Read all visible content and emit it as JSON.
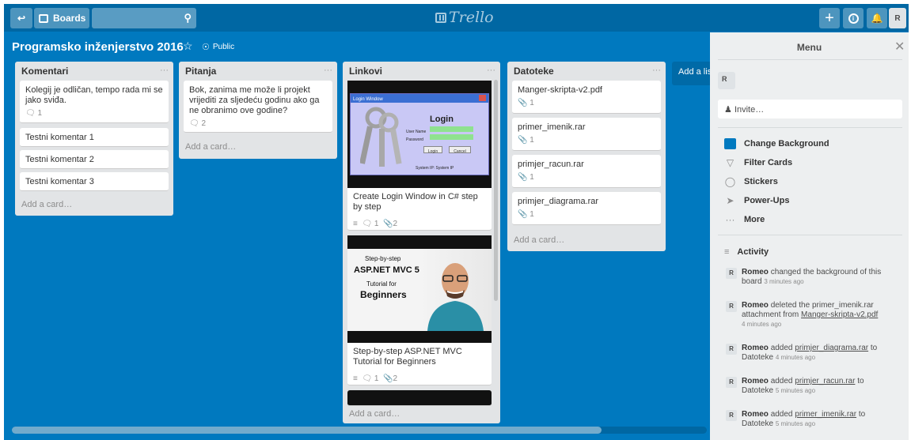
{
  "header": {
    "boards_label": "Boards",
    "logo_text": "Trello",
    "avatar": "R"
  },
  "board": {
    "title": "Programsko inženjerstvo 2016",
    "visibility": "Public"
  },
  "lists": [
    {
      "title": "Komentari",
      "cards": [
        {
          "text": "Kolegij je odličan, tempo rada mi se jako sviđa.",
          "comments": "1"
        },
        {
          "text": "Testni komentar 1"
        },
        {
          "text": "Testni komentar 2"
        },
        {
          "text": "Testni komentar 3"
        }
      ],
      "add": "Add a card…"
    },
    {
      "title": "Pitanja",
      "cards": [
        {
          "text": "Bok, zanima me može li projekt vrijediti za sljedeću godinu ako ga ne obranimo ove godine?",
          "comments": "2"
        }
      ],
      "add": "Add a card…"
    },
    {
      "title": "Linkovi",
      "cards": [
        {
          "text": "Create Login Window in C# step by step",
          "comments": "1",
          "attachments": "2",
          "cover": {
            "window_title": "Login Window",
            "heading": "Login",
            "user_label": "User Name",
            "pass_label": "Password",
            "login_btn": "Login",
            "cancel_btn": "Cancel",
            "footer": "System IP: System IP"
          }
        },
        {
          "text": "Step-by-step ASP.NET MVC Tutorial for Beginners",
          "comments": "1",
          "attachments": "2",
          "cover": {
            "line1": "Step-by-step",
            "line2": "ASP.NET MVC 5",
            "line3": "Tutorial for",
            "line4": "Beginners"
          }
        }
      ],
      "add": "Add a card…"
    },
    {
      "title": "Datoteke",
      "cards": [
        {
          "text": "Manger-skripta-v2.pdf",
          "attachments": "1"
        },
        {
          "text": "primer_imenik.rar",
          "attachments": "1"
        },
        {
          "text": "primjer_racun.rar",
          "attachments": "1"
        },
        {
          "text": "primjer_diagrama.rar",
          "attachments": "1"
        }
      ],
      "add": "Add a card…"
    }
  ],
  "add_list": "Add a list…",
  "sidebar": {
    "title": "Menu",
    "member": "R",
    "invite": "Invite…",
    "items": [
      "Change Background",
      "Filter Cards",
      "Stickers",
      "Power-Ups",
      "More"
    ],
    "activity_title": "Activity",
    "activity": [
      {
        "user": "Romeo",
        "pre": "changed the background of this board",
        "link": "",
        "post": "",
        "time": "3 minutes ago"
      },
      {
        "user": "Romeo",
        "pre": "deleted the primer_imenik.rar attachment from",
        "link": "Manger-skripta-v2.pdf",
        "post": "",
        "time": "4 minutes ago"
      },
      {
        "user": "Romeo",
        "pre": "added",
        "link": "primjer_diagrama.rar",
        "post": "to Datoteke",
        "time": "4 minutes ago"
      },
      {
        "user": "Romeo",
        "pre": "added",
        "link": "primjer_racun.rar",
        "post": "to Datoteke",
        "time": "5 minutes ago"
      },
      {
        "user": "Romeo",
        "pre": "added",
        "link": "primer_imenik.rar",
        "post": "to Datoteke",
        "time": "5 minutes ago"
      }
    ]
  }
}
